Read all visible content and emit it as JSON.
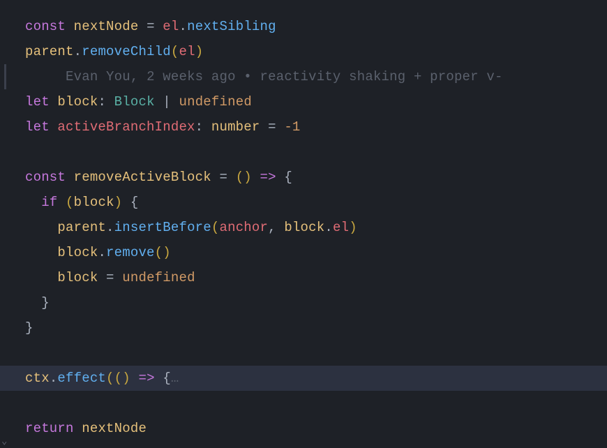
{
  "blame": {
    "author": "Evan You",
    "time": "2 weeks ago",
    "separator": "•",
    "message": "reactivity shaking + proper v-"
  },
  "code": {
    "l1": {
      "kw": "const",
      "v1": "nextNode",
      "eq": "=",
      "v2": "el",
      "dot": ".",
      "prop": "nextSibling"
    },
    "l2": {
      "v1": "parent",
      "dot": ".",
      "fn": "removeChild",
      "lp": "(",
      "arg": "el",
      "rp": ")"
    },
    "l4": {
      "kw": "let",
      "v1": "block",
      "colon": ":",
      "type": "Block",
      "pipe": "|",
      "und": "undefined"
    },
    "l5": {
      "kw": "let",
      "v1": "activeBranchIndex",
      "colon": ":",
      "type": "number",
      "eq": "=",
      "num": "-1"
    },
    "l7": {
      "kw": "const",
      "v1": "removeActiveBlock",
      "eq": "=",
      "lp": "(",
      "rp": ")",
      "arrow": "=>",
      "brace": "{"
    },
    "l8": {
      "kw": "if",
      "lp": "(",
      "v1": "block",
      "rp": ")",
      "brace": "{"
    },
    "l9": {
      "v1": "parent",
      "dot": ".",
      "fn": "insertBefore",
      "lp": "(",
      "a1": "anchor",
      "comma": ",",
      "a2": "block",
      "dot2": ".",
      "prop": "el",
      "rp": ")"
    },
    "l10": {
      "v1": "block",
      "dot": ".",
      "fn": "remove",
      "lp": "(",
      "rp": ")"
    },
    "l11": {
      "v1": "block",
      "eq": "=",
      "und": "undefined"
    },
    "l12": {
      "brace": "}"
    },
    "l13": {
      "brace": "}"
    },
    "l15": {
      "v1": "ctx",
      "dot": ".",
      "fn": "effect",
      "lp1": "(",
      "lp2": "(",
      "rp2": ")",
      "arrow": "=>",
      "brace": "{",
      "fold": "…"
    },
    "l17": {
      "kw": "return",
      "v1": "nextNode"
    }
  },
  "folded_marker": "⌄"
}
